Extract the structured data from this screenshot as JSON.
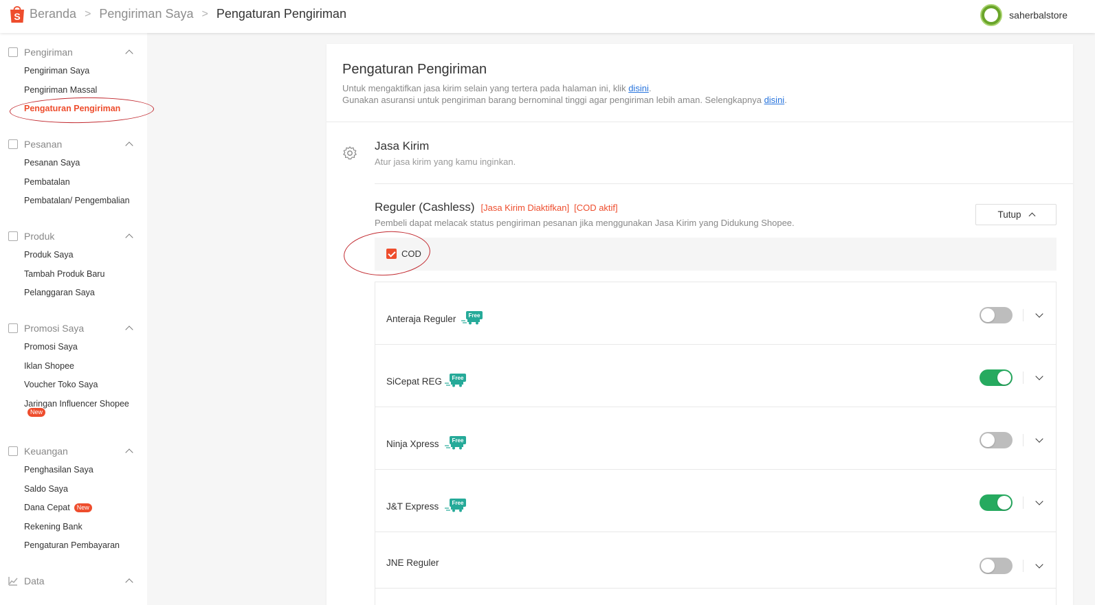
{
  "breadcrumb": {
    "items": [
      "Beranda",
      "Pengiriman Saya",
      "Pengaturan Pengiriman"
    ],
    "separator": ">"
  },
  "user": {
    "name": "saherbalstore"
  },
  "sidebar": {
    "sections": [
      {
        "title": "Pengiriman",
        "icon": "shipping-icon",
        "items": [
          "Pengiriman Saya",
          "Pengiriman Massal",
          "Pengaturan Pengiriman"
        ]
      },
      {
        "title": "Pesanan",
        "icon": "order-icon",
        "items": [
          "Pesanan Saya",
          "Pembatalan",
          "Pembatalan/ Pengembalian"
        ]
      },
      {
        "title": "Produk",
        "icon": "product-icon",
        "items": [
          "Produk Saya",
          "Tambah Produk Baru",
          "Pelanggaran Saya"
        ]
      },
      {
        "title": "Promosi Saya",
        "icon": "tag-icon",
        "items": [
          "Promosi Saya",
          "Iklan Shopee",
          "Voucher Toko Saya",
          "Jaringan Influencer Shopee"
        ]
      },
      {
        "title": "Keuangan",
        "icon": "wallet-icon",
        "items": [
          "Penghasilan Saya",
          "Saldo Saya",
          "Dana Cepat",
          "Rekening Bank",
          "Pengaturan Pembayaran"
        ]
      },
      {
        "title": "Data",
        "icon": "chart-icon",
        "items": []
      }
    ],
    "new_badge": "New",
    "active_item": "Pengaturan Pengiriman"
  },
  "main": {
    "title": "Pengaturan Pengiriman",
    "desc1_prefix": "Untuk mengaktifkan jasa kirim selain yang tertera pada halaman ini, klik ",
    "desc1_link": "disini",
    "desc1_suffix": ".",
    "desc2_prefix": "Gunakan asuransi untuk pengiriman barang bernominal tinggi agar pengiriman lebih aman. Selengkapnya ",
    "desc2_link": "disini",
    "desc2_suffix": ".",
    "jasa_kirim": {
      "title": "Jasa Kirim",
      "subtitle": "Atur jasa kirim yang kamu inginkan."
    },
    "reguler": {
      "title": "Reguler (Cashless)",
      "tag1": "[Jasa Kirim Diaktifkan]",
      "tag2": "[COD aktif]",
      "subtitle": "Pembeli dapat melacak status pengiriman pesanan jika menggunakan Jasa Kirim yang Didukung Shopee.",
      "toggle_button": "Tutup",
      "cod_label": "COD",
      "cod_checked": true
    },
    "couriers": [
      {
        "name": "Anteraja Reguler",
        "free": true,
        "enabled": false
      },
      {
        "name": "SiCepat REG",
        "free": true,
        "enabled": true
      },
      {
        "name": "Ninja Xpress",
        "free": true,
        "enabled": false
      },
      {
        "name": "J&T Express",
        "free": true,
        "enabled": true
      },
      {
        "name": "JNE Reguler",
        "free": false,
        "enabled": false
      }
    ],
    "free_label": "Free"
  },
  "colors": {
    "brand": "#ee4d2d",
    "toggle_on": "#26aa5f",
    "toggle_off": "#bdbdbd",
    "link": "#2673dd",
    "annotation": "#c1272d"
  }
}
